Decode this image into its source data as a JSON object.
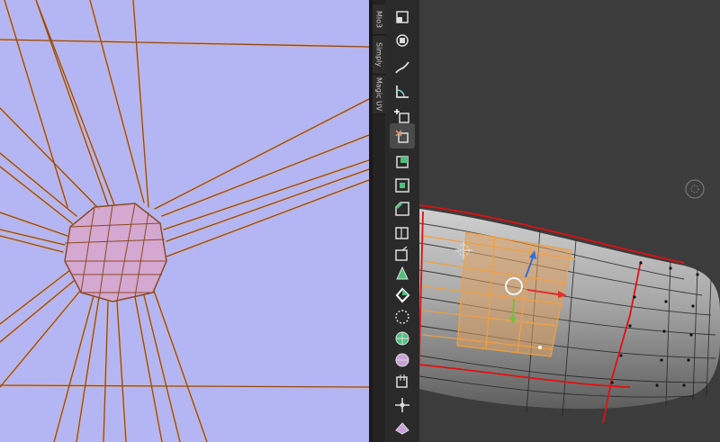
{
  "side_tabs": [
    {
      "label": "Mio3"
    },
    {
      "label": "Simply"
    },
    {
      "label": "Magic UV"
    }
  ],
  "toolbar": {
    "tools": [
      {
        "icon": "cursor-icon"
      },
      {
        "icon": "transform-icon"
      },
      {
        "icon": "annotate-icon"
      },
      {
        "icon": "measure-icon"
      },
      {
        "icon": "add-cube-icon"
      },
      {
        "icon": "extrude-region-icon"
      },
      {
        "icon": "extrude-normals-icon"
      },
      {
        "icon": "inset-faces-icon"
      },
      {
        "icon": "bevel-icon"
      },
      {
        "icon": "loop-cut-icon"
      },
      {
        "icon": "knife-icon"
      },
      {
        "icon": "poly-build-icon"
      },
      {
        "icon": "spin-icon"
      },
      {
        "icon": "smooth-icon"
      },
      {
        "icon": "edge-slide-icon"
      },
      {
        "icon": "shrink-fatten-icon"
      },
      {
        "icon": "shear-icon"
      },
      {
        "icon": "rip-region-icon"
      }
    ]
  },
  "colors": {
    "uv_background": "#b4b6f3",
    "uv_edge": "#8a4a22",
    "uv_edge_highlight": "#e08a4a",
    "viewport_background": "#3c3c3c",
    "mesh_surface": "#a6a6a6",
    "selected_face": "#e0a060",
    "seam_edge": "#e01010",
    "gizmo_x": "#e03030",
    "gizmo_y": "#70c040",
    "gizmo_z": "#3070e0"
  }
}
